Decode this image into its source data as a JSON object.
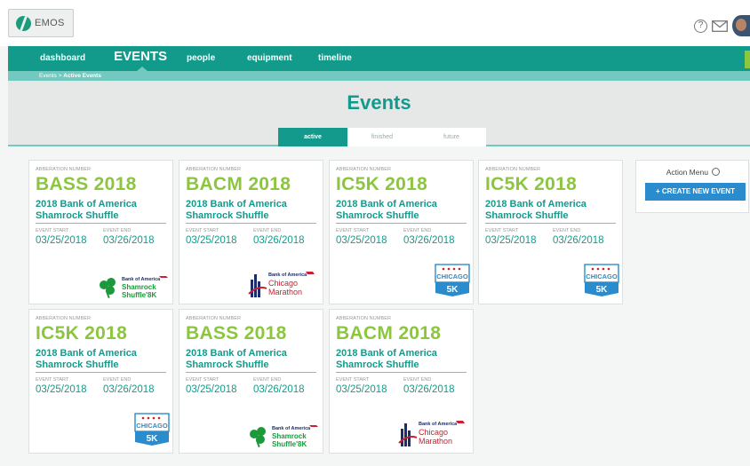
{
  "app": {
    "logo_text": "EMOS"
  },
  "nav": {
    "items": [
      {
        "label": "dashboard"
      },
      {
        "label": "EVENTS"
      },
      {
        "label": "people"
      },
      {
        "label": "equipment"
      },
      {
        "label": "timeline"
      }
    ]
  },
  "breadcrumb": {
    "root": "Events",
    "separator": " > ",
    "current": "Active Events"
  },
  "page": {
    "title": "Events"
  },
  "tabs": [
    {
      "label": "active",
      "active": true
    },
    {
      "label": "finished",
      "active": false
    },
    {
      "label": "future",
      "active": false
    }
  ],
  "labels": {
    "abbreviation": "ABBERATION NUMBER",
    "event_start": "EVENT START",
    "event_end": "EVENT END"
  },
  "events": [
    {
      "abbr": "BASS 2018",
      "name": "2018 Bank of America Shamrock Shuffle",
      "start": "03/25/2018",
      "end": "03/26/2018",
      "logo": "shamrock-shuffle-logo"
    },
    {
      "abbr": "BACM 2018",
      "name": "2018 Bank of America Shamrock Shuffle",
      "start": "03/25/2018",
      "end": "03/26/2018",
      "logo": "chicago-marathon-logo"
    },
    {
      "abbr": "IC5K 2018",
      "name": "2018 Bank of America Shamrock Shuffle",
      "start": "03/25/2018",
      "end": "03/26/2018",
      "logo": "chicago-5k-logo"
    },
    {
      "abbr": "IC5K 2018",
      "name": "2018 Bank of America Shamrock Shuffle",
      "start": "03/25/2018",
      "end": "03/26/2018",
      "logo": "chicago-5k-logo"
    },
    {
      "abbr": "IC5K 2018",
      "name": "2018 Bank of America Shamrock Shuffle",
      "start": "03/25/2018",
      "end": "03/26/2018",
      "logo": "chicago-5k-logo"
    },
    {
      "abbr": "BASS 2018",
      "name": "2018 Bank of America Shamrock Shuffle",
      "start": "03/25/2018",
      "end": "03/26/2018",
      "logo": "shamrock-shuffle-logo"
    },
    {
      "abbr": "BACM 2018",
      "name": "2018 Bank of America Shamrock Shuffle",
      "start": "03/25/2018",
      "end": "03/26/2018",
      "logo": "chicago-marathon-logo"
    }
  ],
  "logos": {
    "bank": "Bank of America",
    "shamrock_1": "Shamrock",
    "shamrock_2": "Shuffle'8K",
    "marathon_1": "Chicago",
    "marathon_2": "Marathon",
    "chicago": "CHICAGO",
    "five_k": "5K"
  },
  "action_menu": {
    "title": "Action Menu",
    "create_label": "+ CREATE NEW EVENT"
  },
  "colors": {
    "teal": "#129a8b",
    "green": "#8cc63f",
    "light_teal": "#72c9bf",
    "button_blue": "#2a8ccd"
  }
}
